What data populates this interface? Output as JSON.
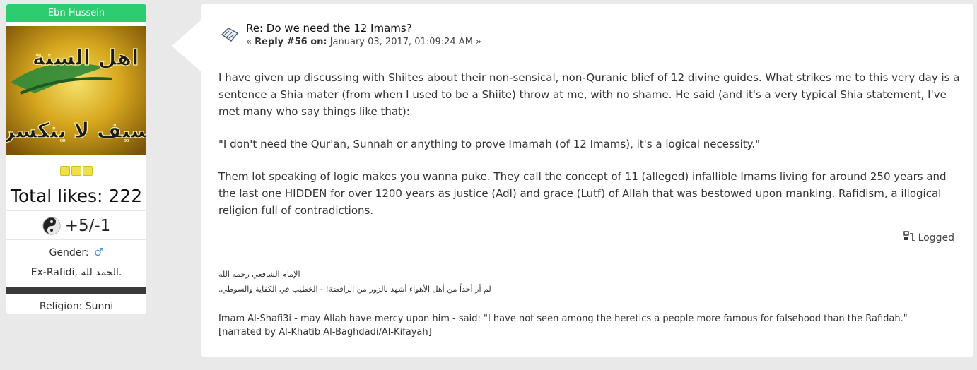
{
  "user": {
    "name": "Ebn Hussein",
    "likes": "Total likes: 222",
    "karma": "+5/-1",
    "gender_label": "Gender:",
    "personal_text": "Ex-Rafidi, الحمد لله.",
    "religion": "Religion: Sunni",
    "avatar_text_top": "اهل السنة",
    "avatar_text_bottom": "سيف لا ينكسر"
  },
  "post": {
    "subject": "Re: Do we need the 12 Imams?",
    "reply_prefix": "« ",
    "reply_label": "Reply #56 on:",
    "reply_date": " January 03, 2017, 01:09:24 AM »",
    "paragraphs": [
      "I have given up discussing with Shiites about their non-sensical, non-Quranic blief of 12 divine guides. What strikes me to this very day is a sentence a Shia mater (from when I used to be a Shiite) throw at me, with no shame. He said (and it's a very typical Shia statement, I've met many who say things like that):",
      "\"I don't need the Qur'an, Sunnah or anything to prove Imamah (of 12 Imams), it's a logical necessity.\"",
      "Them lot speaking of logic makes you wanna puke. They call the concept of 11 (alleged) infallible Imams living for around 250 years and the last one HIDDEN for over 1200 years as justice (Adl) and grace (Lutf) of Allah that was bestowed upon manking. Rafidism, a illogical religion full of contradictions."
    ],
    "logged_label": "Logged"
  },
  "signature": {
    "arabic_line1": "الإمام الشافعي رحمه الله",
    "arabic_line2": "لم أر أحداً من أهل الأهواء أشهد بالزور من الرافضة! - الخطيب في الكفاية والسوطي.",
    "english_line1": "Imam Al-Shafi3i - may Allah have mercy upon him - said: \"I have not seen among the heretics a people more famous for falsehood than the Rafidah.\"",
    "english_line2": "[narrated by Al-Khatib Al-Baghdadi/Al-Kifayah]"
  },
  "colors": {
    "username_bar": "#2ecc71",
    "background": "#e9e9e9",
    "star": "#efe04a",
    "gender_icon": "#3a8fd8"
  }
}
